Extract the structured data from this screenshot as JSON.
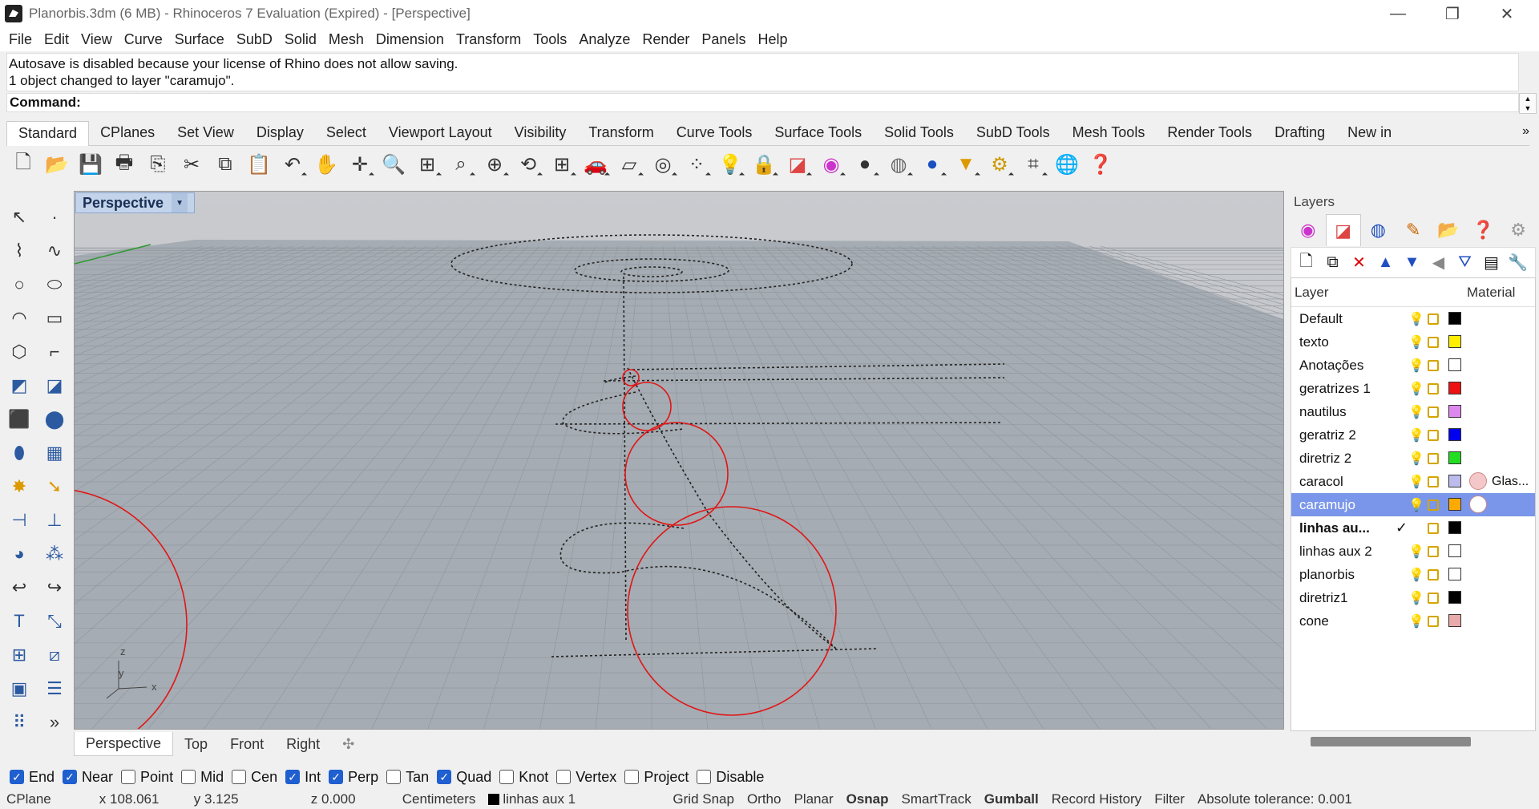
{
  "window": {
    "title": "Planorbis.3dm (6 MB) - Rhinoceros 7 Evaluation (Expired) - [Perspective]",
    "minimize": "—",
    "restore": "❐",
    "close": "✕"
  },
  "menu": [
    "File",
    "Edit",
    "View",
    "Curve",
    "Surface",
    "SubD",
    "Solid",
    "Mesh",
    "Dimension",
    "Transform",
    "Tools",
    "Analyze",
    "Render",
    "Panels",
    "Help"
  ],
  "command": {
    "history": [
      "Autosave is disabled because your license of Rhino does not allow saving.",
      "1 object changed to layer \"caramujo\"."
    ],
    "prompt": "Command:"
  },
  "toolbar_tabs": [
    "Standard",
    "CPlanes",
    "Set View",
    "Display",
    "Select",
    "Viewport Layout",
    "Visibility",
    "Transform",
    "Curve Tools",
    "Surface Tools",
    "Solid Tools",
    "SubD Tools",
    "Mesh Tools",
    "Render Tools",
    "Drafting",
    "New in"
  ],
  "toolbar_more": "»",
  "viewport": {
    "title": "Perspective",
    "dropdown": "▼",
    "tabs": [
      "Perspective",
      "Top",
      "Front",
      "Right"
    ],
    "add_tab": "✣",
    "axis": {
      "z": "z",
      "y": "y",
      "x": "x"
    }
  },
  "layers_panel": {
    "title": "Layers",
    "col_layer": "Layer",
    "col_material": "Material",
    "layers": [
      {
        "name": "Default",
        "color": "#000000",
        "bulb": "#e6c200"
      },
      {
        "name": "texto",
        "color": "#ffee00",
        "bulb": "#e6c200"
      },
      {
        "name": "Anotações",
        "color": "#ffffff",
        "bulb": "#3a6fd0"
      },
      {
        "name": "geratrizes 1",
        "color": "#ee1111",
        "bulb": "#e6c200"
      },
      {
        "name": "nautilus",
        "color": "#dd88ee",
        "bulb": "#3a6fd0"
      },
      {
        "name": "geratriz 2",
        "color": "#0000ee",
        "bulb": "#3a6fd0"
      },
      {
        "name": "diretriz 2",
        "color": "#22dd22",
        "bulb": "#e6c200"
      },
      {
        "name": "caracol",
        "color": "#bbbbee",
        "bulb": "#3a6fd0",
        "material": "Glas...",
        "matcolor": "#f4c8c8"
      },
      {
        "name": "caramujo",
        "color": "#ffaa00",
        "bulb": "#3a6fd0",
        "selected": true,
        "matcolor": "#ffffff"
      },
      {
        "name": "linhas au...",
        "color": "#000000",
        "current": true,
        "check": "✓"
      },
      {
        "name": "linhas aux 2",
        "color": "#ffffff",
        "bulb": "#3a6fd0"
      },
      {
        "name": "planorbis",
        "color": "#ffffff",
        "bulb": "#3a6fd0"
      },
      {
        "name": "diretriz1",
        "color": "#000000",
        "bulb": "#e6c200"
      },
      {
        "name": "cone",
        "color": "#e8aaaa",
        "bulb": "#3a6fd0"
      }
    ]
  },
  "osnaps": [
    {
      "label": "End",
      "on": true
    },
    {
      "label": "Near",
      "on": true
    },
    {
      "label": "Point",
      "on": false
    },
    {
      "label": "Mid",
      "on": false
    },
    {
      "label": "Cen",
      "on": false
    },
    {
      "label": "Int",
      "on": true
    },
    {
      "label": "Perp",
      "on": true
    },
    {
      "label": "Tan",
      "on": false
    },
    {
      "label": "Quad",
      "on": true
    },
    {
      "label": "Knot",
      "on": false
    },
    {
      "label": "Vertex",
      "on": false
    },
    {
      "label": "Project",
      "on": false
    },
    {
      "label": "Disable",
      "on": false
    }
  ],
  "status": {
    "cplane": "CPlane",
    "x": "x 108.061",
    "y": "y 3.125",
    "z": "z 0.000",
    "units": "Centimeters",
    "layer": "linhas aux 1",
    "grid_snap": "Grid Snap",
    "ortho": "Ortho",
    "planar": "Planar",
    "osnap": "Osnap",
    "smarttrack": "SmartTrack",
    "gumball": "Gumball",
    "record_history": "Record History",
    "filter": "Filter",
    "tolerance": "Absolute tolerance: 0.001"
  }
}
